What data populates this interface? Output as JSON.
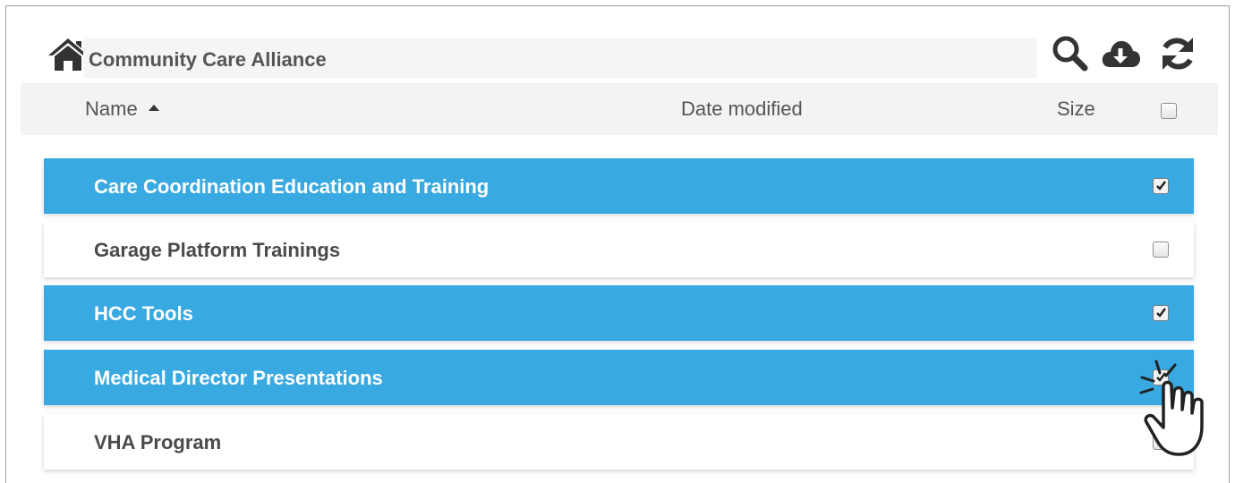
{
  "breadcrumb": {
    "current_folder": "Community Care Alliance"
  },
  "toolbar": {
    "icons": [
      "search-icon",
      "cloud-download-icon",
      "refresh-icon"
    ]
  },
  "table": {
    "columns": {
      "name": "Name",
      "date_modified": "Date modified",
      "size": "Size"
    },
    "sort": {
      "column": "name",
      "direction": "ascending"
    },
    "select_all_checked": false,
    "rows": [
      {
        "name": "Care Coordination Education and Training",
        "selected": true
      },
      {
        "name": "Garage Platform Trainings",
        "selected": false
      },
      {
        "name": "HCC Tools",
        "selected": true
      },
      {
        "name": "Medical Director Presentations",
        "selected": true
      },
      {
        "name": "VHA Program",
        "selected": false
      }
    ]
  },
  "colors": {
    "selected_row": "#39a9e1",
    "header_bg": "#f3f3f3",
    "text": "#555555",
    "icon": "#333333"
  }
}
